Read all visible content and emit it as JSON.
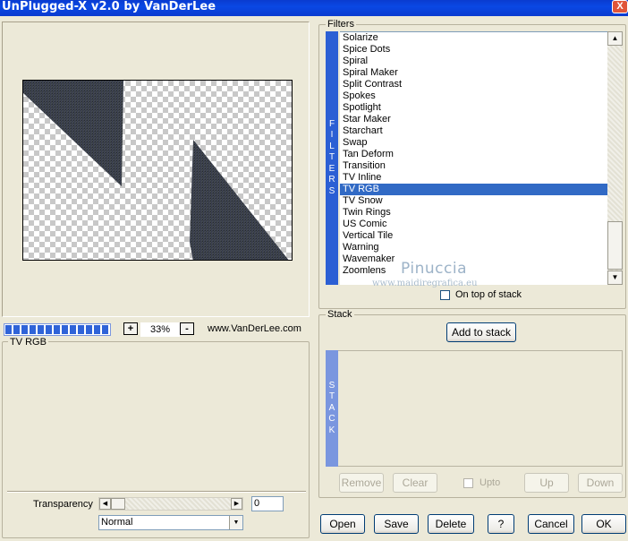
{
  "window": {
    "title": "UnPlugged-X v2.0 by VanDerLee",
    "close_label": "X"
  },
  "preview": {
    "zoom": "33%",
    "zoom_in": "+",
    "zoom_out": "-",
    "website": "www.VanDerLee.com",
    "progress_fraction": 1.0
  },
  "filters": {
    "group_label": "Filters",
    "tab_letters": [
      "F",
      "I",
      "L",
      "T",
      "E",
      "R",
      "S"
    ],
    "items": [
      "Solarize",
      "Spice Dots",
      "Spiral",
      "Spiral Maker",
      "Split Contrast",
      "Spokes",
      "Spotlight",
      "Star Maker",
      "Starchart",
      "Swap",
      "Tan Deform",
      "Transition",
      "TV Inline",
      "TV RGB",
      "TV Snow",
      "Twin Rings",
      "US Comic",
      "Vertical Tile",
      "Warning",
      "Wavemaker",
      "Zoomlens"
    ],
    "selected": "TV RGB",
    "on_top_label": "On top of stack"
  },
  "watermark": {
    "name": "Pinuccia",
    "url": "www.maidiregrafica.eu"
  },
  "stack": {
    "group_label": "Stack",
    "add_label": "Add to stack",
    "tab_letters": [
      "S",
      "T",
      "A",
      "C",
      "K"
    ],
    "remove_label": "Remove",
    "clear_label": "Clear",
    "upto_label": "Upto",
    "up_label": "Up",
    "down_label": "Down"
  },
  "effect": {
    "group_label": "TV RGB",
    "transparency_label": "Transparency",
    "transparency_value": "0",
    "blend_mode": "Normal"
  },
  "footer": {
    "open": "Open",
    "save": "Save",
    "delete": "Delete",
    "help": "?",
    "cancel": "Cancel",
    "ok": "OK"
  }
}
